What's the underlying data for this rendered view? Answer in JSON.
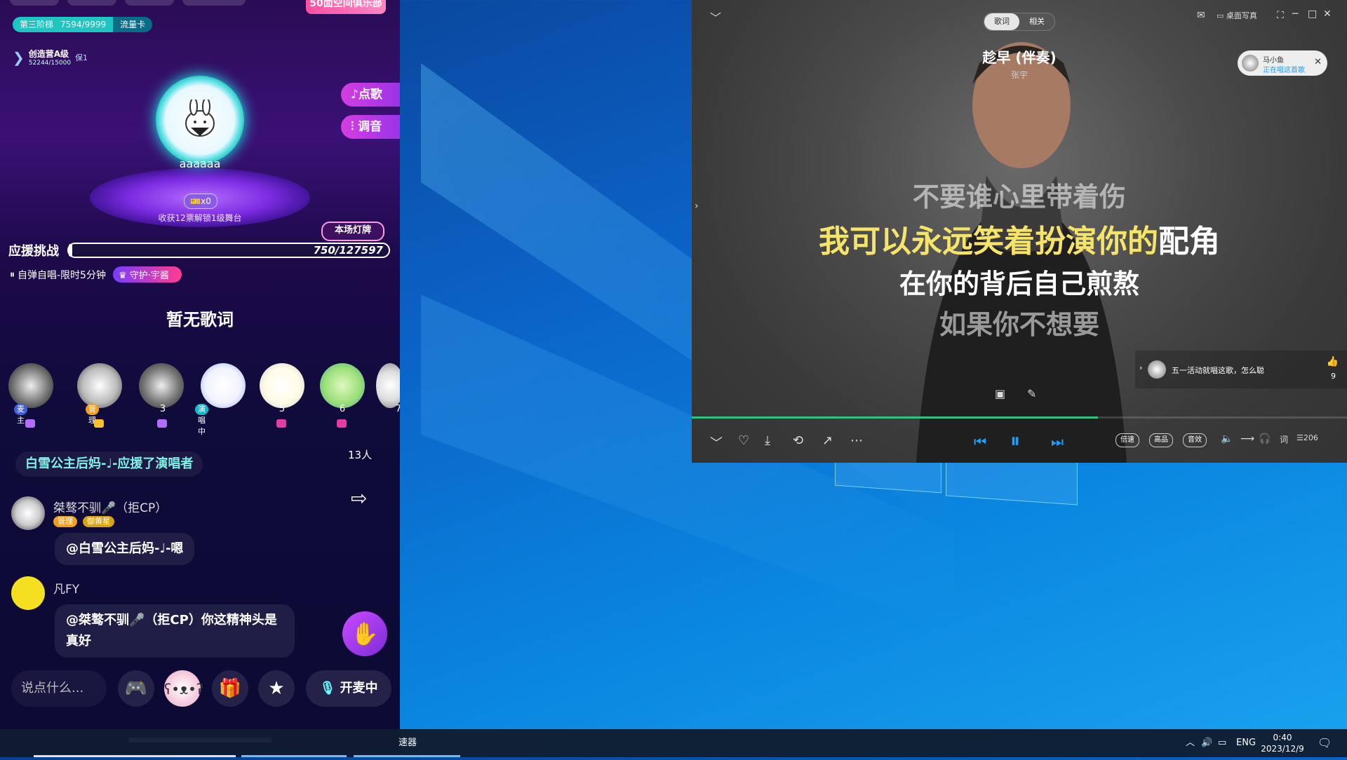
{
  "phone": {
    "banner_top": "50面空间俱乐部",
    "level_stage": "第三阶梯",
    "level_score": "7594/9999",
    "level_card": "流量卡",
    "creator_title": "创造营A级",
    "creator_num": "52244/15000",
    "creator_tag": "保1",
    "btn_request": "♪点歌",
    "btn_tune": "调音",
    "stage_name": "aaaaaa",
    "stage_badge": "x0",
    "unlock_text": "收获12票解锁1级舞台",
    "light_card": "本场灯牌",
    "support_label": "应援挑战",
    "support_value": "750/127597",
    "support_progress": 0.0059,
    "self_sing": "自弹自唱-限时5分钟",
    "guard_label": "守护·宇酱",
    "no_lyric": "暂无歌词",
    "seats": [
      {
        "tag": "麦主",
        "num": ""
      },
      {
        "tag": "管理",
        "num": ""
      },
      {
        "tag": "",
        "num": "3"
      },
      {
        "tag": "演唱中",
        "num": ""
      },
      {
        "tag": "",
        "num": "5"
      },
      {
        "tag": "",
        "num": "6"
      },
      {
        "tag": "",
        "num": "7"
      }
    ],
    "sys_msg": "白雪公主后妈-♩-应援了演唱者",
    "online_count": "13人",
    "chat": [
      {
        "name": "桀骜不驯🎤（拒CP）",
        "tags": [
          "管理",
          "御黄星"
        ],
        "text": "@白雪公主后妈-♩-嗯"
      },
      {
        "name": "凡FY",
        "tags": [],
        "text": "@桀骜不驯🎤（拒CP）你这精神头是真好"
      }
    ],
    "input_placeholder": "说点什么...",
    "mic_label": "开麦中"
  },
  "player": {
    "tab_lyrics": "歌词",
    "tab_related": "相关",
    "desktop_lyrics": "桌面写真",
    "song_title": "趁早 (伴奏)",
    "artist": "张宇",
    "listener_name": "马小鱼",
    "listener_status": "正在唱这首歌",
    "lyrics": [
      {
        "text": "不要谁心里带着伤",
        "state": "past"
      },
      {
        "sung": "我可以永远笑着扮演你的",
        "rest": "配角",
        "state": "current"
      },
      {
        "text": "在你的背后自己煎熬",
        "state": "next"
      },
      {
        "text": "如果你不想要",
        "state": "future"
      }
    ],
    "comment_text": "五一活动就唱这歌，怎么聪",
    "like_count": "9",
    "progress": 0.62,
    "pill_speed": "倍速",
    "pill_quality": "高品",
    "pill_effect": "音效",
    "lyric_btn": "词",
    "playlist_count": "206"
  },
  "taskbar": {
    "partial_app": "速器",
    "lang": "ENG",
    "time": "0:40",
    "date": "2023/12/9"
  }
}
